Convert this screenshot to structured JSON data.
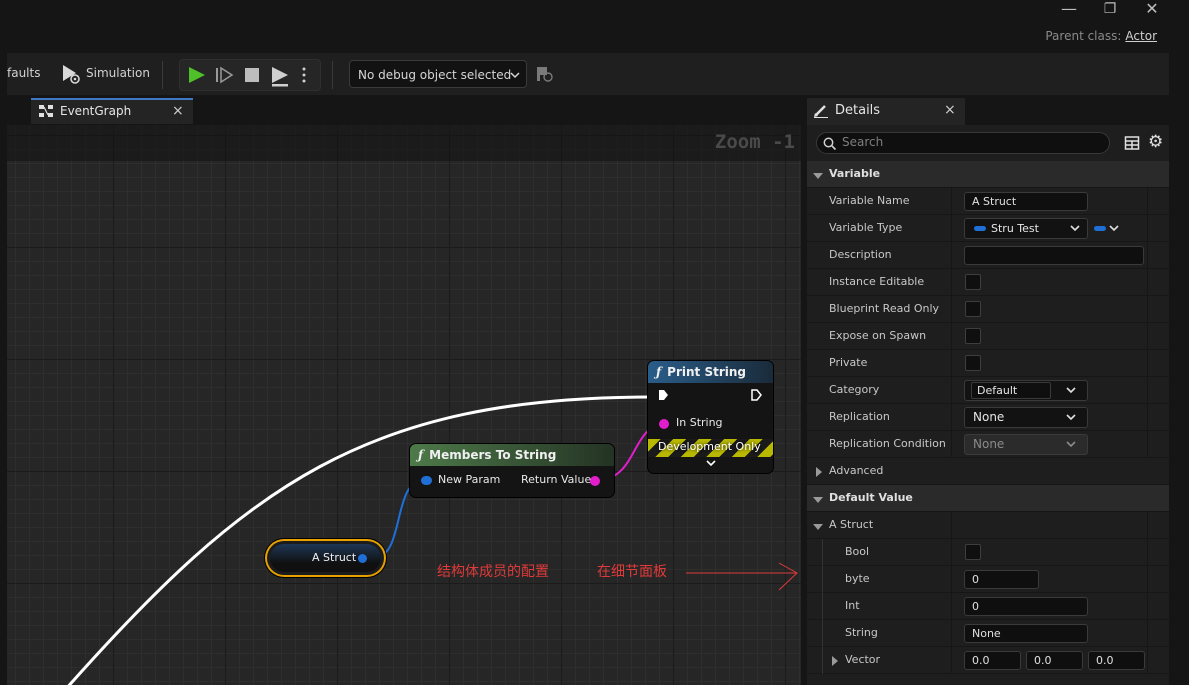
{
  "window": {
    "minimize_icon": "—",
    "restore_icon": "❐",
    "close_icon": "✕",
    "parent_class_label": "Parent class:",
    "parent_class_value": "Actor"
  },
  "toolbar": {
    "defaults_label": "faults",
    "simulation_label": "Simulation",
    "debug_select_value": "No debug object selected"
  },
  "tabs": {
    "event_graph": "EventGraph",
    "details": "Details",
    "close_glyph": "×"
  },
  "graph": {
    "zoom_label": "Zoom -1",
    "nodes": {
      "print_string": {
        "title": "Print String",
        "pin_in_string": "In String",
        "dev_only": "Development Only"
      },
      "members_to_string": {
        "title": "Members To String",
        "pin_new_param": "New Param",
        "pin_return_value": "Return Value"
      },
      "a_struct": {
        "title": "A Struct"
      }
    },
    "annotations": {
      "note1": "结构体成员的配置",
      "note2": "在细节面板"
    },
    "colors": {
      "exec_wire": "#ffffff",
      "struct_wire": "#1f6fd6",
      "string_wire": "#e21ecc",
      "selection": "#e6a100"
    }
  },
  "details": {
    "search_placeholder": "Search",
    "sections": {
      "variable": "Variable",
      "advanced": "Advanced",
      "default_value": "Default Value",
      "a_struct": "A Struct"
    },
    "rows": {
      "variable_name": {
        "label": "Variable Name",
        "value": "A Struct"
      },
      "variable_type": {
        "label": "Variable Type",
        "value": "Stru Test"
      },
      "description": {
        "label": "Description",
        "value": ""
      },
      "instance_editable": {
        "label": "Instance Editable"
      },
      "blueprint_read_only": {
        "label": "Blueprint Read Only"
      },
      "expose_on_spawn": {
        "label": "Expose on Spawn"
      },
      "private": {
        "label": "Private"
      },
      "category": {
        "label": "Category",
        "value": "Default"
      },
      "replication": {
        "label": "Replication",
        "value": "None"
      },
      "replication_condition": {
        "label": "Replication Condition",
        "value": "None"
      },
      "bool": {
        "label": "Bool"
      },
      "byte": {
        "label": "byte",
        "value": "0"
      },
      "int": {
        "label": "Int",
        "value": "0"
      },
      "string": {
        "label": "String",
        "value": "None"
      },
      "vector": {
        "label": "Vector",
        "x": "0.0",
        "y": "0.0",
        "z": "0.0"
      }
    }
  }
}
